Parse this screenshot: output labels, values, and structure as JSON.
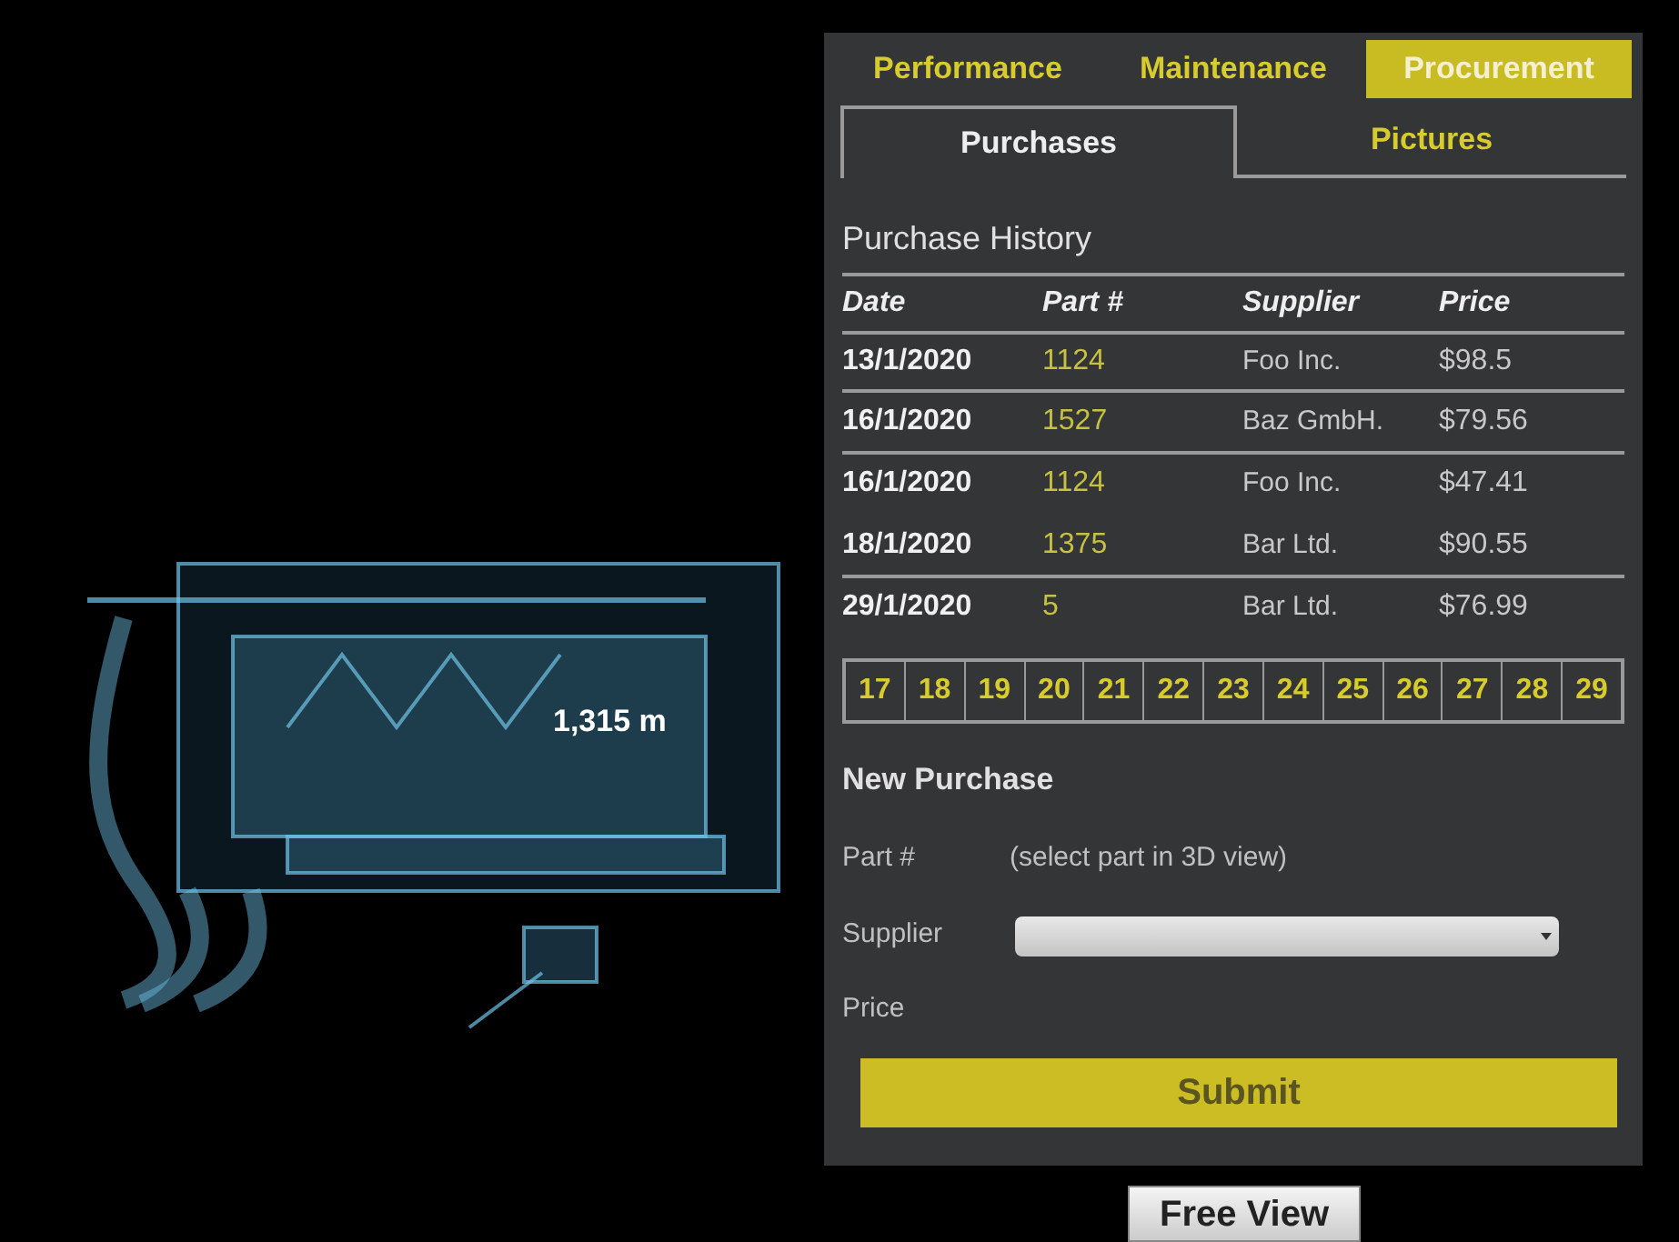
{
  "viewport": {
    "measurement": "1,315 m"
  },
  "main_tabs": [
    {
      "label": "Performance",
      "selected": false
    },
    {
      "label": "Maintenance",
      "selected": false
    },
    {
      "label": "Procurement",
      "selected": true
    }
  ],
  "sub_tabs": [
    {
      "label": "Purchases",
      "selected": true
    },
    {
      "label": "Pictures",
      "selected": false
    }
  ],
  "purchase_history": {
    "title": "Purchase History",
    "columns": [
      "Date",
      "Part #",
      "Supplier",
      "Price"
    ],
    "rows": [
      {
        "date": "13/1/2020",
        "part": "1124",
        "supplier": "Foo Inc.",
        "price": "$98.5",
        "rule_below": true
      },
      {
        "date": "16/1/2020",
        "part": "1527",
        "supplier": "Baz GmbH.",
        "price": "$79.56",
        "rule_below": true
      },
      {
        "date": "16/1/2020",
        "part": "1124",
        "supplier": "Foo Inc.",
        "price": "$47.41",
        "rule_below": false
      },
      {
        "date": "18/1/2020",
        "part": "1375",
        "supplier": "Bar Ltd.",
        "price": "$90.55",
        "rule_below": true
      },
      {
        "date": "29/1/2020",
        "part": "5",
        "supplier": "Bar Ltd.",
        "price": "$76.99",
        "rule_below": false
      }
    ],
    "pages": [
      "17",
      "18",
      "19",
      "20",
      "21",
      "22",
      "23",
      "24",
      "25",
      "26",
      "27",
      "28",
      "29"
    ]
  },
  "new_purchase": {
    "title": "New Purchase",
    "part_label": "Part #",
    "part_hint": "(select part in 3D view)",
    "supplier_label": "Supplier",
    "price_label": "Price",
    "submit": "Submit"
  },
  "free_view_button": "Free View"
}
